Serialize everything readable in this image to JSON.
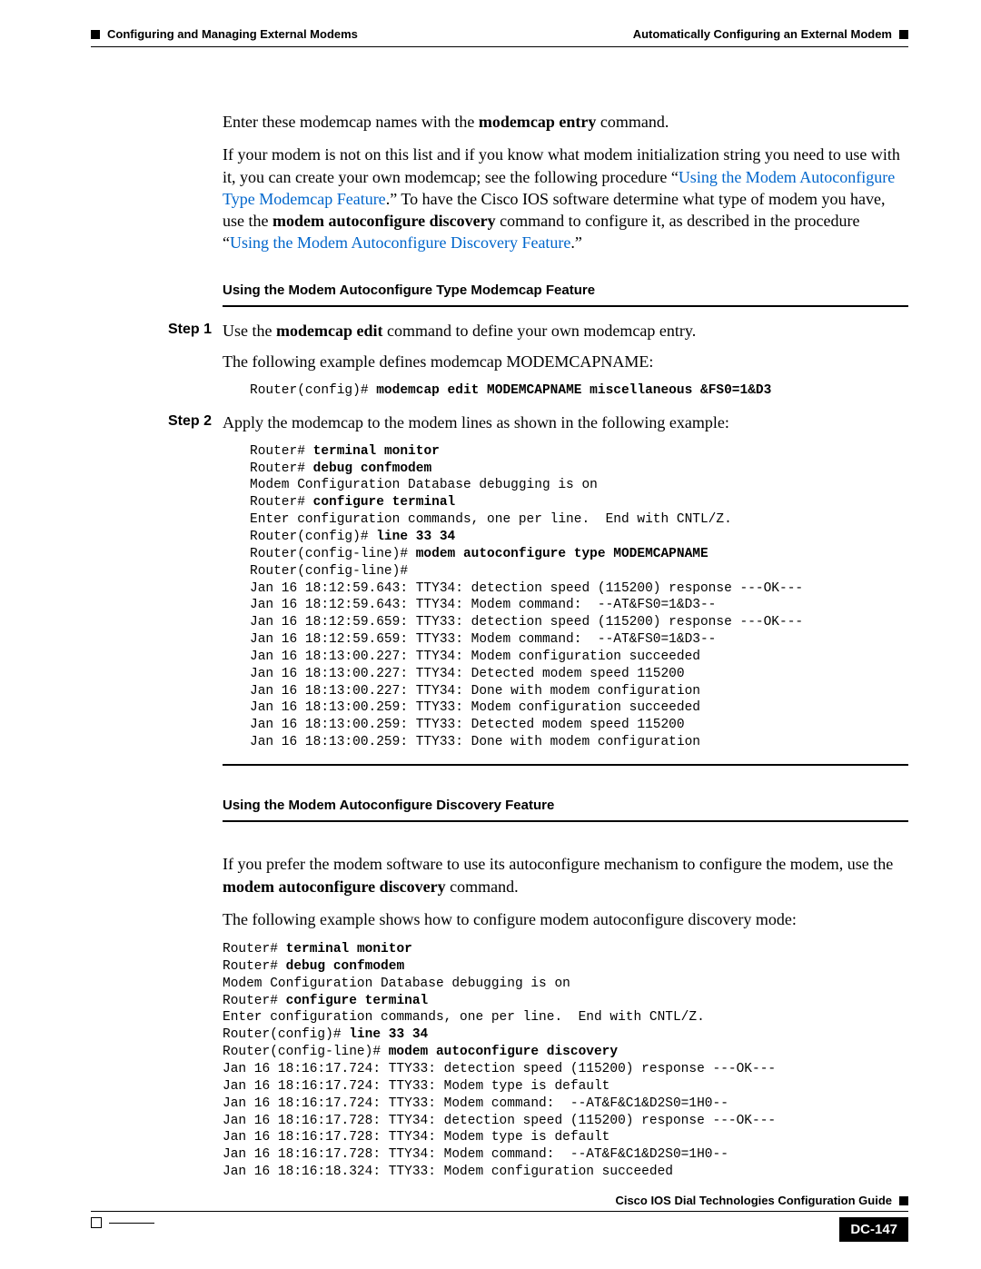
{
  "header": {
    "chapter": "Configuring and Managing External Modems",
    "section": "Automatically Configuring an External Modem"
  },
  "intro": {
    "p1_a": "Enter these modemcap names with the ",
    "p1_b": "modemcap entry",
    "p1_c": " command.",
    "p2_a": "If your modem is not on this list and if you know what modem initialization string you need to use with it, you can create your own modemcap; see the following procedure “",
    "p2_link1": "Using the Modem Autoconfigure Type Modemcap Feature",
    "p2_b": ".” To have the Cisco IOS software determine what type of modem you have, use the ",
    "p2_bold": "modem autoconfigure discovery",
    "p2_c": " command to configure it, as described in the procedure “",
    "p2_link2": "Using the Modem Autoconfigure Discovery Feature",
    "p2_d": ".”"
  },
  "section1": {
    "title": "Using the Modem Autoconfigure Type Modemcap Feature",
    "step1_label": "Step 1",
    "step1_a": "Use the ",
    "step1_bold": "modemcap edit",
    "step1_b": " command to define your own modemcap entry.",
    "step1_p2": "The following example defines modemcap MODEMCAPNAME:",
    "code1_prefix": "Router(config)# ",
    "code1_bold": "modemcap edit MODEMCAPNAME miscellaneous &FS0=1&D3",
    "step2_label": "Step 2",
    "step2_a": "Apply the modemcap to the modem lines as shown in the following example:",
    "code2_l1a": "Router# ",
    "code2_l1b": "terminal monitor",
    "code2_l2a": "Router# ",
    "code2_l2b": "debug confmodem",
    "code2_l3": "Modem Configuration Database debugging is on",
    "code2_l4a": "Router# ",
    "code2_l4b": "configure terminal",
    "code2_l5": "Enter configuration commands, one per line.  End with CNTL/Z.",
    "code2_l6a": "Router(config)# ",
    "code2_l6b": "line 33 34",
    "code2_l7a": "Router(config-line)# ",
    "code2_l7b": "modem autoconfigure type MODEMCAPNAME",
    "code2_l8": "Router(config-line)#",
    "code2_l9": "Jan 16 18:12:59.643: TTY34: detection speed (115200) response ---OK---",
    "code2_l10": "Jan 16 18:12:59.643: TTY34: Modem command:  --AT&FS0=1&D3--",
    "code2_l11": "Jan 16 18:12:59.659: TTY33: detection speed (115200) response ---OK---",
    "code2_l12": "Jan 16 18:12:59.659: TTY33: Modem command:  --AT&FS0=1&D3--",
    "code2_l13": "Jan 16 18:13:00.227: TTY34: Modem configuration succeeded",
    "code2_l14": "Jan 16 18:13:00.227: TTY34: Detected modem speed 115200",
    "code2_l15": "Jan 16 18:13:00.227: TTY34: Done with modem configuration",
    "code2_l16": "Jan 16 18:13:00.259: TTY33: Modem configuration succeeded",
    "code2_l17": "Jan 16 18:13:00.259: TTY33: Detected modem speed 115200",
    "code2_l18": "Jan 16 18:13:00.259: TTY33: Done with modem configuration"
  },
  "section2": {
    "title": "Using the Modem Autoconfigure Discovery Feature",
    "p1_a": "If you prefer the modem software to use its autoconfigure mechanism to configure the modem, use the ",
    "p1_bold": "modem autoconfigure discovery",
    "p1_b": " command.",
    "p2": "The following example shows how to configure modem autoconfigure discovery mode:",
    "code3_l1a": "Router# ",
    "code3_l1b": "terminal monitor",
    "code3_l2a": "Router# ",
    "code3_l2b": "debug confmodem",
    "code3_l3": "Modem Configuration Database debugging is on",
    "code3_l4a": "Router# ",
    "code3_l4b": "configure terminal",
    "code3_l5": "Enter configuration commands, one per line.  End with CNTL/Z.",
    "code3_l6a": "Router(config)# ",
    "code3_l6b": "line 33 34",
    "code3_l7a": "Router(config-line)# ",
    "code3_l7b": "modem autoconfigure discovery",
    "code3_l8": "Jan 16 18:16:17.724: TTY33: detection speed (115200) response ---OK---",
    "code3_l9": "Jan 16 18:16:17.724: TTY33: Modem type is default",
    "code3_l10": "Jan 16 18:16:17.724: TTY33: Modem command:  --AT&F&C1&D2S0=1H0--",
    "code3_l11": "Jan 16 18:16:17.728: TTY34: detection speed (115200) response ---OK---",
    "code3_l12": "Jan 16 18:16:17.728: TTY34: Modem type is default",
    "code3_l13": "Jan 16 18:16:17.728: TTY34: Modem command:  --AT&F&C1&D2S0=1H0--",
    "code3_l14": "Jan 16 18:16:18.324: TTY33: Modem configuration succeeded"
  },
  "footer": {
    "guide": "Cisco IOS Dial Technologies Configuration Guide",
    "page": "DC-147"
  }
}
